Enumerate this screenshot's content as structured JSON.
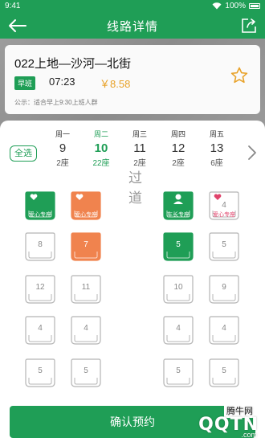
{
  "status": {
    "time": "9:41",
    "battery": "100%"
  },
  "nav": {
    "title": "线路详情",
    "back_icon": "arrow-left-icon",
    "share_icon": "share-edit-icon"
  },
  "route": {
    "name": "022上地—沙河—北街",
    "tag": "早班",
    "time": "07:23",
    "price": "￥8.58",
    "notice": "公示：适合早上9:30上班人群",
    "favorite_icon": "star-outline-icon"
  },
  "schedule": {
    "select_all": "全选",
    "days": [
      {
        "weekday": "周一",
        "date": "9",
        "seats": "2座",
        "active": false
      },
      {
        "weekday": "周二",
        "date": "10",
        "seats": "22座",
        "active": true
      },
      {
        "weekday": "周三",
        "date": "11",
        "seats": "2座",
        "active": false
      },
      {
        "weekday": "周四",
        "date": "12",
        "seats": "2座",
        "active": false
      },
      {
        "weekday": "周五",
        "date": "13",
        "seats": "6座",
        "active": false
      }
    ]
  },
  "seats": {
    "special": [
      {
        "label": "爱心专座",
        "style": "green"
      },
      {
        "label": "爱心专座",
        "style": "orange"
      },
      {
        "label": "车长专座",
        "style": "green"
      },
      {
        "num": "4",
        "label": "爱心专座",
        "style": "outline"
      }
    ],
    "rows": [
      [
        "8",
        "7",
        "5",
        "5"
      ],
      [
        "12",
        "11",
        "10",
        "9"
      ],
      [
        "4",
        "4",
        "4",
        "4"
      ],
      [
        "5",
        "5",
        "5",
        "5"
      ]
    ],
    "aisle": "过道"
  },
  "booking": {
    "button": "确认预约"
  },
  "watermark": {
    "cn": "腾牛网",
    "logo": "QQTN",
    "domain": ".com"
  },
  "colors": {
    "primary": "#1f9e56",
    "accent": "#e8a229",
    "orange": "#f0834e",
    "heart": "#e0436b"
  }
}
